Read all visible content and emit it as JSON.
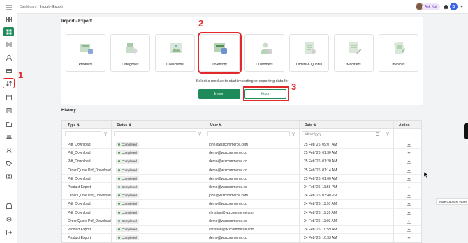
{
  "breadcrumb": {
    "parent": "Dashboard",
    "sep": "/",
    "current": "Import - Export"
  },
  "user": {
    "name": "Ask Kai",
    "initial": "D"
  },
  "card": {
    "title": "Import - Export",
    "modules": [
      {
        "label": "Products",
        "icon": "products-illustration"
      },
      {
        "label": "Categories",
        "icon": "categories-illustration"
      },
      {
        "label": "Collections",
        "icon": "collections-illustration"
      },
      {
        "label": "Inventory",
        "icon": "inventory-illustration",
        "selected": true
      },
      {
        "label": "Customers",
        "icon": "customers-illustration"
      },
      {
        "label": "Orders & Quotes",
        "icon": "orders-illustration"
      },
      {
        "label": "Modifiers",
        "icon": "modifiers-illustration"
      },
      {
        "label": "Invoices",
        "icon": "invoices-illustration"
      }
    ],
    "subtitle": "Select a module to start importing or exporting data for",
    "import_label": "Import",
    "export_label": "Export"
  },
  "annotations": {
    "a1": "1",
    "a2": "2",
    "a3": "3"
  },
  "history": {
    "title": "History",
    "columns": {
      "type": "Type",
      "status": "Status",
      "user": "User",
      "date": "Date",
      "action": "Action"
    },
    "date_placeholder": "dd/mm/yyyy",
    "rows": [
      {
        "type": "Pdf_Download",
        "status": "Completed",
        "user": "john@wizcommerce.com",
        "date": "25 Feb' 26, 09:07 AM"
      },
      {
        "type": "Pdf_Download",
        "status": "Completed",
        "user": "demo@wizcommerce.co",
        "date": "25 Feb' 26, 01:30 AM"
      },
      {
        "type": "Pdf_Download",
        "status": "Completed",
        "user": "demo@wizcommerce.co",
        "date": "25 Feb' 26, 01:20 AM"
      },
      {
        "type": "Order/Quote Pdf_Download",
        "status": "Completed",
        "user": "demo@wizcommerce.co",
        "date": "25 Feb' 26, 01:14 AM"
      },
      {
        "type": "Pdf_Download",
        "status": "Completed",
        "user": "demo@wizcommerce.co",
        "date": "25 Feb' 26, 01:06 AM"
      },
      {
        "type": "Product Export",
        "status": "Completed",
        "user": "demo@wizcommerce.co",
        "date": "24 Feb' 26, 11:56 PM"
      },
      {
        "type": "Order/Quote Pdf_Download",
        "status": "Completed",
        "user": "john@wizcommerce.com",
        "date": "24 Feb' 26, 03:40 PM"
      },
      {
        "type": "Pdf_Download",
        "status": "Completed",
        "user": "demo@wizcommerce.co",
        "date": "24 Feb' 26, 11:57 AM"
      },
      {
        "type": "Pdf_Download",
        "status": "Completed",
        "user": "christian@wizcommerce.com",
        "date": "24 Feb' 26, 11:20 AM"
      },
      {
        "type": "Order/Quote Pdf_Download",
        "status": "Completed",
        "user": "demo@wizcommerce.co",
        "date": "24 Feb' 26, 11:03 AM"
      },
      {
        "type": "Product Export",
        "status": "Completed",
        "user": "christian@wizcommerce.com",
        "date": "24 Feb' 26, 10:59 AM"
      },
      {
        "type": "Product Export",
        "status": "Completed",
        "user": "demo@wizcommerce.co",
        "date": "24 Feb' 26, 10:53 AM"
      }
    ]
  },
  "tooltip": "More Capture Types",
  "colors": {
    "primary": "#1f8a5a",
    "annotation": "#e2282a",
    "user_pill": "#eee5f8",
    "avatar": "#3a63e0"
  }
}
